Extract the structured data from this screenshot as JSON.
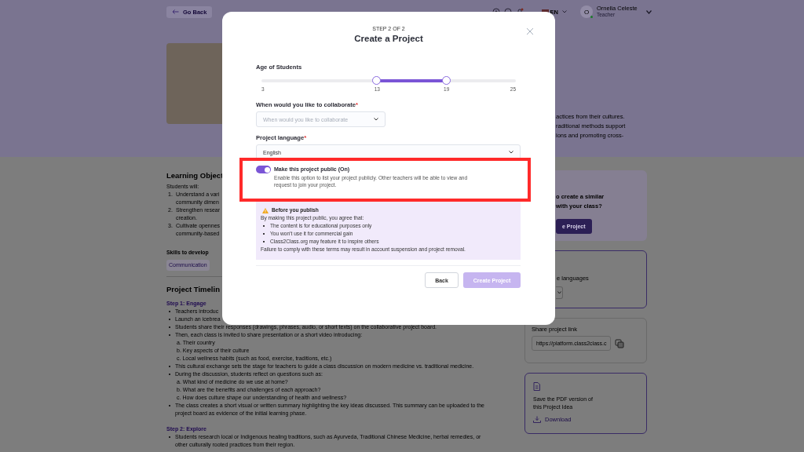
{
  "header": {
    "back_link": "Go Back",
    "language": "EN",
    "user": {
      "initial": "O",
      "name": "Ornella Celeste",
      "role": "Teacher",
      "online": true
    }
  },
  "hero": {
    "text_lines": [
      "actices from their cultures.",
      "raditional methods support",
      "ions and promoting cross-"
    ]
  },
  "learning_objectives": {
    "title": "Learning Object",
    "intro": "Students will:",
    "items": [
      {
        "marker": "1.",
        "lines": [
          "Understand a vari",
          "community dimen"
        ]
      },
      {
        "marker": "2.",
        "lines": [
          "Strengthen resear",
          "creation."
        ]
      },
      {
        "marker": "3.",
        "lines": [
          "Cultivate opennes",
          "community-based"
        ]
      }
    ]
  },
  "skills": {
    "title": "Skills to develop",
    "tags": [
      "Communication"
    ]
  },
  "timeline": {
    "title": "Project Timelin",
    "steps": [
      {
        "title": "Step 1: Engage",
        "items": [
          {
            "text": "Teachers introduc"
          },
          {
            "text": "Launch an icebrea"
          },
          {
            "text": "Students share their responses (drawings, phrases, audio, or short texts) on the collaborative project board."
          },
          {
            "text": "Then, each class is invited to share presentation or a short video introducing:",
            "children": [
              {
                "marker": "a.",
                "text": "Their country"
              },
              {
                "marker": "b.",
                "text": "Key aspects of their culture"
              },
              {
                "marker": "c.",
                "text": "Local wellness habits (such as food, exercise, traditions, etc.)"
              }
            ]
          },
          {
            "text": "This cultural exchange sets the stage for teachers to guide a class discussion on modern medicine vs. traditional medicine."
          },
          {
            "text": "During the discussion, students reflect on questions such as:",
            "children": [
              {
                "marker": "a.",
                "text": "What kind of medicine do we use at home?"
              },
              {
                "marker": "b.",
                "text": "What are the benefits and challenges of each approach?"
              },
              {
                "marker": "c.",
                "text": "How does culture shape our understanding of health and wellness?"
              }
            ]
          },
          {
            "text": "The class creates a short visual or written summary highlighting the key ideas discussed. This summary can be uploaded to the project board as evidence of the initial learning phase."
          }
        ]
      },
      {
        "title": "Step 2: Explore",
        "items": [
          {
            "text": "Students research local or Indigenous healing traditions, such as Ayurveda, Traditional Chinese Medicine, herbal remedies, or other culturally rooted practices from their region."
          }
        ]
      }
    ]
  },
  "sidebar": {
    "cta": {
      "lines": [
        "o create a similar",
        "with your class?"
      ],
      "button": "e Project"
    },
    "languages": {
      "text": "e languages"
    },
    "share": {
      "title": "Share project link",
      "url": "https://platform.class2class.c"
    },
    "pdf": {
      "lines": [
        "Save the PDF version of",
        "this Project Idea"
      ],
      "link": "Download"
    }
  },
  "modal": {
    "step": "STEP 2 OF 2",
    "title": "Create a Project",
    "age": {
      "label": "Age of Students",
      "thumbs": [
        {
          "level": 0.4545
        },
        {
          "level": 0.7273
        }
      ],
      "ticks": [
        "3",
        "13",
        "19",
        "25"
      ]
    },
    "fields": [
      {
        "label": "When would you like to collaborate",
        "required_mark": "*",
        "placeholder": "When would you like to collaborate"
      },
      {
        "label": "Project language",
        "required_mark": "*",
        "value": "English"
      }
    ],
    "public_toggle": {
      "on": true,
      "label": "Make this project public (On)",
      "description": "Enable this option to list your project publicly. Other teachers will be able to view and request to join your project.",
      "highlighted": true
    },
    "notice": {
      "title": "Before you publish",
      "intro": "By making this project public, you agree that:",
      "items": [
        "The content is for educational purposes only",
        "You won’t use it for commercial gain",
        "Class2Class.org may feature it to inspire others"
      ],
      "footer": "Failure to comply with these terms may result in account suspension and project removal."
    },
    "buttons": [
      {
        "label": "Back",
        "kind": "secondary",
        "disabled": false
      },
      {
        "label": "Create Project",
        "kind": "primary",
        "disabled": true
      }
    ]
  }
}
